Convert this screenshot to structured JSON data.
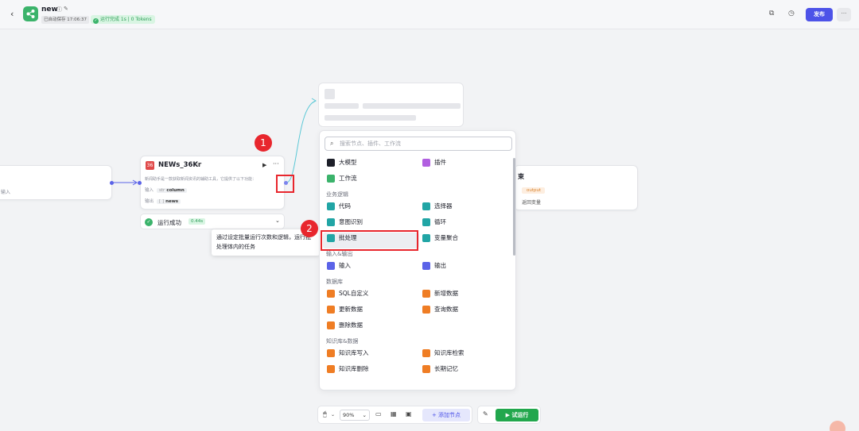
{
  "header": {
    "back_icon": "chevron-left-icon",
    "app_name": "new",
    "autosave": "已自动保存 17:06:37",
    "run_status": "运行完成 1s | 0 Tokens",
    "publish": "发布",
    "more": "···"
  },
  "canvas": {
    "start_node": {
      "label": "输入"
    },
    "news_node": {
      "title": "NEWs_36Kr",
      "description": "新闻助手是一款获取新闻资讯的辅助工具，它提供了以下功能：",
      "input_label": "输入",
      "input_type": "str",
      "input_value": "column",
      "output_label": "输出",
      "output_type": "[ ]",
      "output_value": "news"
    },
    "run_result": {
      "text": "运行成功",
      "time": "0.44s"
    },
    "tooltip": "通过设定批量运行次数和逻辑，运行批处理体内的任务",
    "end_node": {
      "title": "束",
      "output_tag": "output",
      "return_label": "返回变量"
    },
    "markers": [
      "1",
      "2"
    ]
  },
  "panel": {
    "search_placeholder": "搜索节点、插件、工作流",
    "top_items": [
      {
        "label": "大模型",
        "icon": "llm-icon",
        "color": "#1d1f29"
      },
      {
        "label": "插件",
        "icon": "plugin-icon",
        "color": "#b15fe0"
      },
      {
        "label": "工作流",
        "icon": "workflow-icon",
        "color": "#3bb36b"
      }
    ],
    "sections": [
      {
        "title": "业务逻辑",
        "items": [
          {
            "label": "代码",
            "icon": "code-icon",
            "color": "#21a5a5"
          },
          {
            "label": "选择器",
            "icon": "if-icon",
            "color": "#21a5a5"
          },
          {
            "label": "意图识别",
            "icon": "intent-icon",
            "color": "#21a5a5"
          },
          {
            "label": "循环",
            "icon": "loop-icon",
            "color": "#21a5a5"
          },
          {
            "label": "批处理",
            "icon": "batch-icon",
            "color": "#21a5a5"
          },
          {
            "label": "变量聚合",
            "icon": "variable-merge-icon",
            "color": "#21a5a5"
          }
        ]
      },
      {
        "title": "输入&输出",
        "items": [
          {
            "label": "输入",
            "icon": "input-icon",
            "color": "#5b63e8"
          },
          {
            "label": "输出",
            "icon": "output-icon",
            "color": "#5b63e8"
          }
        ]
      },
      {
        "title": "数据库",
        "items": [
          {
            "label": "SQL自定义",
            "icon": "sql-icon",
            "color": "#ef7d24"
          },
          {
            "label": "新增数据",
            "icon": "add-data-icon",
            "color": "#ef7d24"
          },
          {
            "label": "更新数据",
            "icon": "update-data-icon",
            "color": "#ef7d24"
          },
          {
            "label": "查询数据",
            "icon": "query-data-icon",
            "color": "#ef7d24"
          },
          {
            "label": "删除数据",
            "icon": "delete-data-icon",
            "color": "#ef7d24"
          }
        ]
      },
      {
        "title": "知识库&数据",
        "items": [
          {
            "label": "知识库写入",
            "icon": "kb-write-icon",
            "color": "#ef7d24"
          },
          {
            "label": "知识库检索",
            "icon": "kb-search-icon",
            "color": "#ef7d24"
          },
          {
            "label": "知识库删除",
            "icon": "kb-delete-icon",
            "color": "#ef7d24"
          },
          {
            "label": "长期记忆",
            "icon": "memory-icon",
            "color": "#ef7d24"
          }
        ]
      }
    ]
  },
  "bottom": {
    "zoom": "90%",
    "add_node": "+ 添加节点",
    "test_run": "▶ 试运行"
  }
}
